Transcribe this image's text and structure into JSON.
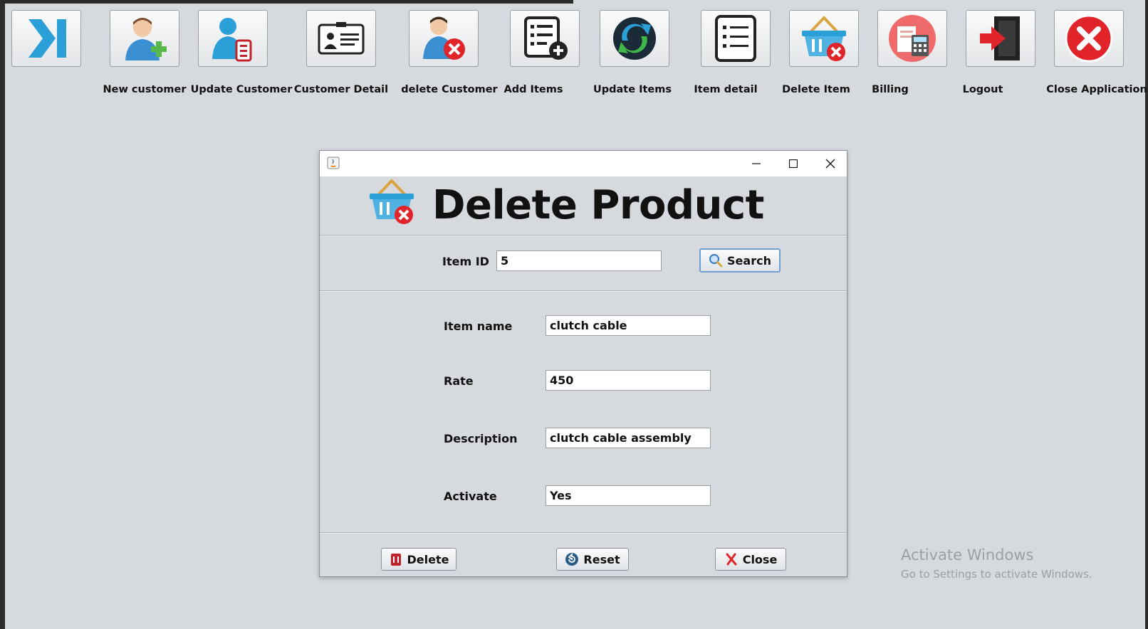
{
  "toolbar": {
    "items": [
      {
        "label": "",
        "icon": "collapse-arrow-icon"
      },
      {
        "label": "New customer",
        "icon": "add-user-icon"
      },
      {
        "label": "Update Customer",
        "icon": "edit-user-icon"
      },
      {
        "label": "Customer Detail",
        "icon": "id-card-icon"
      },
      {
        "label": "delete Customer",
        "icon": "delete-user-icon"
      },
      {
        "label": "Add Items",
        "icon": "add-list-icon"
      },
      {
        "label": "Update Items",
        "icon": "refresh-icon"
      },
      {
        "label": "Item detail",
        "icon": "list-icon"
      },
      {
        "label": "Delete Item",
        "icon": "basket-delete-icon"
      },
      {
        "label": "Billing",
        "icon": "billing-icon"
      },
      {
        "label": "Logout",
        "icon": "logout-door-icon"
      },
      {
        "label": "Close Application",
        "icon": "close-circle-icon"
      }
    ]
  },
  "dialog": {
    "title": "Delete Product",
    "item_id_label": "Item ID",
    "item_id_value": "5",
    "search_label": "Search",
    "fields": {
      "item_name_label": "Item name",
      "item_name_value": "clutch cable",
      "rate_label": "Rate",
      "rate_value": "450",
      "description_label": "Description",
      "description_value": "clutch cable assembly",
      "activate_label": "Activate",
      "activate_value": "Yes"
    },
    "buttons": {
      "delete": "Delete",
      "reset": "Reset",
      "close": "Close"
    }
  },
  "watermark": {
    "line1": "Activate Windows",
    "line2": "Go to Settings to activate Windows."
  },
  "colors": {
    "background": "#d6d9de",
    "accent_blue": "#2a9fd8",
    "danger_red": "#e0242a"
  }
}
